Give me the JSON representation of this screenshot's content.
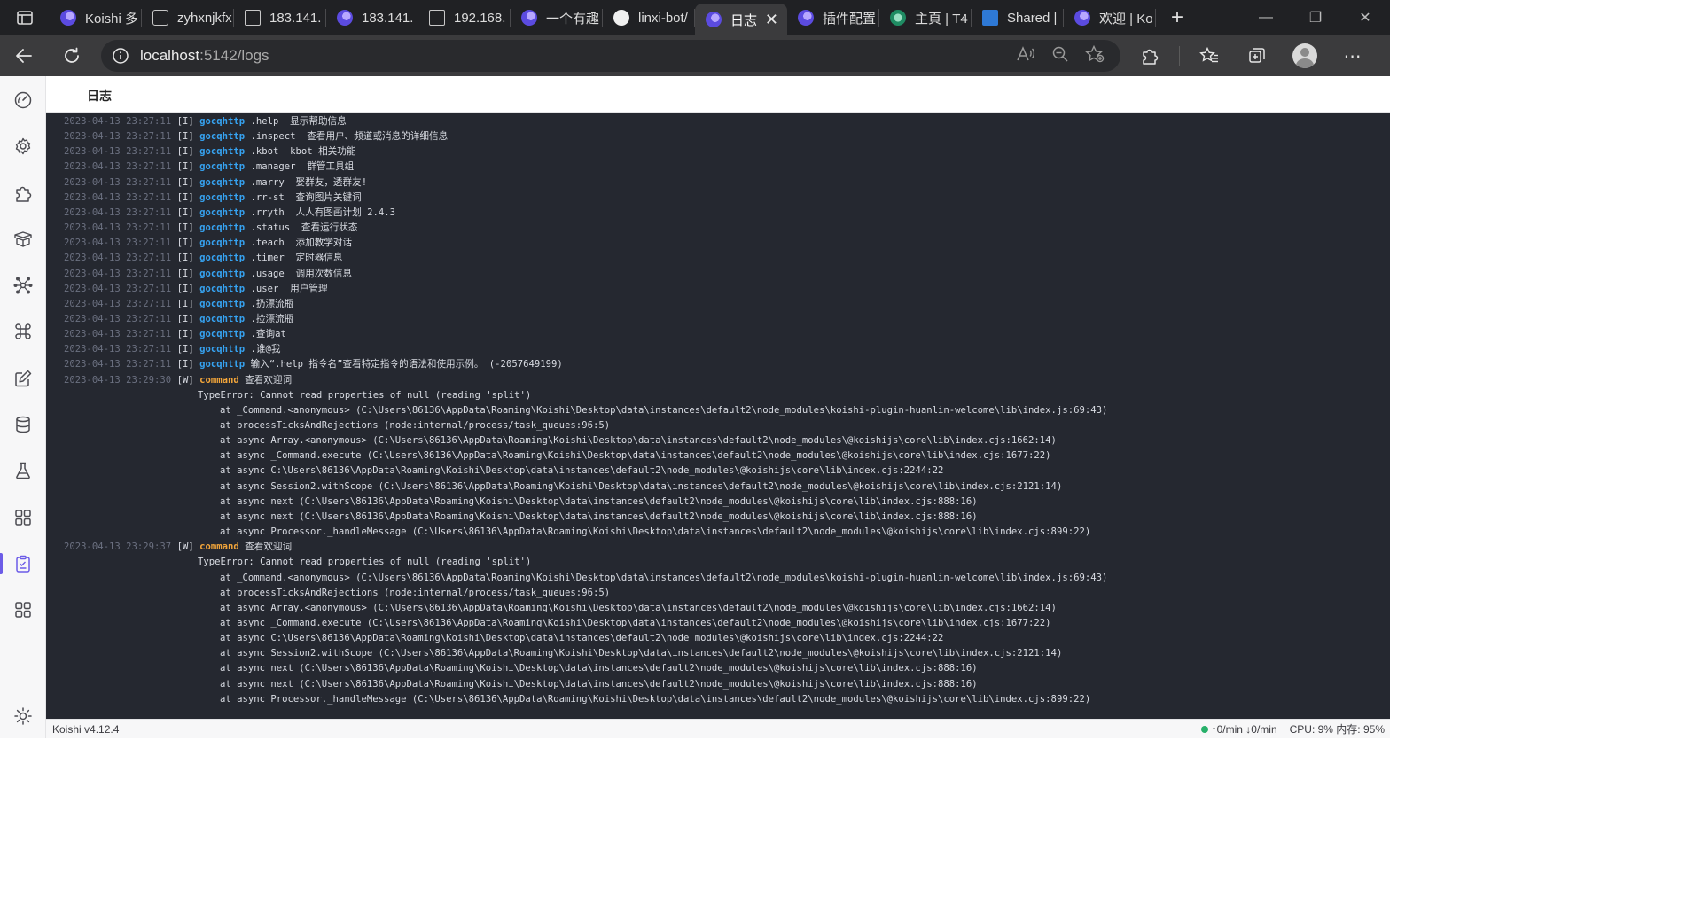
{
  "browser": {
    "tabs": [
      {
        "title": "Koishi 多",
        "favicon": "koishi-favicon",
        "active": false
      },
      {
        "title": "zyhxnjkfx",
        "favicon": "blocked-page-favicon",
        "active": false
      },
      {
        "title": "183.141.",
        "favicon": "document-favicon",
        "active": false
      },
      {
        "title": "183.141.",
        "favicon": "koishi-favicon",
        "active": false
      },
      {
        "title": "192.168.",
        "favicon": "document-favicon",
        "active": false
      },
      {
        "title": "一个有趣",
        "favicon": "koishi-favicon",
        "active": false
      },
      {
        "title": "linxi-bot/",
        "favicon": "github-favicon",
        "active": false
      },
      {
        "title": "日志",
        "favicon": "koishi-favicon",
        "active": true
      },
      {
        "title": "插件配置",
        "favicon": "koishi-favicon",
        "active": false
      },
      {
        "title": "主頁 | T4",
        "favicon": "green-site-favicon",
        "active": false
      },
      {
        "title": "Shared |",
        "favicon": "blue-doc-favicon",
        "active": false
      },
      {
        "title": "欢迎 | Ko",
        "favicon": "koishi-favicon",
        "active": false
      }
    ],
    "address": {
      "host": "localhost",
      "path": ":5142/logs"
    }
  },
  "page": {
    "title": "日志"
  },
  "sidebar": {
    "items": [
      {
        "name": "dashboard-icon",
        "active": false
      },
      {
        "name": "settings-gear-icon",
        "active": false
      },
      {
        "name": "plugin-puzzle-icon",
        "active": false
      },
      {
        "name": "package-box-icon",
        "active": false
      },
      {
        "name": "dependency-graph-icon",
        "active": false
      },
      {
        "name": "command-icon",
        "active": false
      },
      {
        "name": "edit-note-icon",
        "active": false
      },
      {
        "name": "database-icon",
        "active": false
      },
      {
        "name": "sandbox-flask-icon",
        "active": false
      },
      {
        "name": "apps-grid-icon",
        "active": false
      },
      {
        "name": "logs-clipboard-icon",
        "active": true
      },
      {
        "name": "apps-grid-icon-2",
        "active": false
      },
      {
        "name": "theme-sun-icon",
        "active": false
      }
    ]
  },
  "logs": [
    {
      "ts": "2023-04-13 23:27:11",
      "level": "[I]",
      "label": "gocqhttp",
      "msg": ".help  显示帮助信息"
    },
    {
      "ts": "2023-04-13 23:27:11",
      "level": "[I]",
      "label": "gocqhttp",
      "msg": ".inspect  查看用户、频道或消息的详细信息"
    },
    {
      "ts": "2023-04-13 23:27:11",
      "level": "[I]",
      "label": "gocqhttp",
      "msg": ".kbot  kbot 相关功能"
    },
    {
      "ts": "2023-04-13 23:27:11",
      "level": "[I]",
      "label": "gocqhttp",
      "msg": ".manager  群管工具组"
    },
    {
      "ts": "2023-04-13 23:27:11",
      "level": "[I]",
      "label": "gocqhttp",
      "msg": ".marry  娶群友，透群友!"
    },
    {
      "ts": "2023-04-13 23:27:11",
      "level": "[I]",
      "label": "gocqhttp",
      "msg": ".rr-st  查询图片关键词"
    },
    {
      "ts": "2023-04-13 23:27:11",
      "level": "[I]",
      "label": "gocqhttp",
      "msg": ".rryth  人人有图画计划 2.4.3"
    },
    {
      "ts": "2023-04-13 23:27:11",
      "level": "[I]",
      "label": "gocqhttp",
      "msg": ".status  查看运行状态"
    },
    {
      "ts": "2023-04-13 23:27:11",
      "level": "[I]",
      "label": "gocqhttp",
      "msg": ".teach  添加教学对话"
    },
    {
      "ts": "2023-04-13 23:27:11",
      "level": "[I]",
      "label": "gocqhttp",
      "msg": ".timer  定时器信息"
    },
    {
      "ts": "2023-04-13 23:27:11",
      "level": "[I]",
      "label": "gocqhttp",
      "msg": ".usage  调用次数信息"
    },
    {
      "ts": "2023-04-13 23:27:11",
      "level": "[I]",
      "label": "gocqhttp",
      "msg": ".user  用户管理"
    },
    {
      "ts": "2023-04-13 23:27:11",
      "level": "[I]",
      "label": "gocqhttp",
      "msg": ".扔漂流瓶"
    },
    {
      "ts": "2023-04-13 23:27:11",
      "level": "[I]",
      "label": "gocqhttp",
      "msg": ".捡漂流瓶"
    },
    {
      "ts": "2023-04-13 23:27:11",
      "level": "[I]",
      "label": "gocqhttp",
      "msg": ".查询at"
    },
    {
      "ts": "2023-04-13 23:27:11",
      "level": "[I]",
      "label": "gocqhttp",
      "msg": ".谁@我"
    },
    {
      "ts": "2023-04-13 23:27:11",
      "level": "[I]",
      "label": "gocqhttp",
      "msg": "输入“.help 指令名”查看特定指令的语法和使用示例。 (-2057649199)"
    },
    {
      "ts": "2023-04-13 23:29:30",
      "level": "[W]",
      "label": "command",
      "msg": "查看欢迎词"
    },
    {
      "stack": "TypeError: Cannot read properties of null (reading 'split')",
      "indent": 1
    },
    {
      "stack": "at _Command.<anonymous> (C:\\Users\\86136\\AppData\\Roaming\\Koishi\\Desktop\\data\\instances\\default2\\node_modules\\koishi-plugin-huanlin-welcome\\lib\\index.js:69:43)",
      "indent": 2
    },
    {
      "stack": "at processTicksAndRejections (node:internal/process/task_queues:96:5)",
      "indent": 2
    },
    {
      "stack": "at async Array.<anonymous> (C:\\Users\\86136\\AppData\\Roaming\\Koishi\\Desktop\\data\\instances\\default2\\node_modules\\@koishijs\\core\\lib\\index.cjs:1662:14)",
      "indent": 2
    },
    {
      "stack": "at async _Command.execute (C:\\Users\\86136\\AppData\\Roaming\\Koishi\\Desktop\\data\\instances\\default2\\node_modules\\@koishijs\\core\\lib\\index.cjs:1677:22)",
      "indent": 2
    },
    {
      "stack": "at async C:\\Users\\86136\\AppData\\Roaming\\Koishi\\Desktop\\data\\instances\\default2\\node_modules\\@koishijs\\core\\lib\\index.cjs:2244:22",
      "indent": 2
    },
    {
      "stack": "at async Session2.withScope (C:\\Users\\86136\\AppData\\Roaming\\Koishi\\Desktop\\data\\instances\\default2\\node_modules\\@koishijs\\core\\lib\\index.cjs:2121:14)",
      "indent": 2
    },
    {
      "stack": "at async next (C:\\Users\\86136\\AppData\\Roaming\\Koishi\\Desktop\\data\\instances\\default2\\node_modules\\@koishijs\\core\\lib\\index.cjs:888:16)",
      "indent": 2
    },
    {
      "stack": "at async next (C:\\Users\\86136\\AppData\\Roaming\\Koishi\\Desktop\\data\\instances\\default2\\node_modules\\@koishijs\\core\\lib\\index.cjs:888:16)",
      "indent": 2
    },
    {
      "stack": "at async Processor._handleMessage (C:\\Users\\86136\\AppData\\Roaming\\Koishi\\Desktop\\data\\instances\\default2\\node_modules\\@koishijs\\core\\lib\\index.cjs:899:22)",
      "indent": 2
    },
    {
      "ts": "2023-04-13 23:29:37",
      "level": "[W]",
      "label": "command",
      "msg": "查看欢迎词"
    },
    {
      "stack": "TypeError: Cannot read properties of null (reading 'split')",
      "indent": 1
    },
    {
      "stack": "at _Command.<anonymous> (C:\\Users\\86136\\AppData\\Roaming\\Koishi\\Desktop\\data\\instances\\default2\\node_modules\\koishi-plugin-huanlin-welcome\\lib\\index.js:69:43)",
      "indent": 2
    },
    {
      "stack": "at processTicksAndRejections (node:internal/process/task_queues:96:5)",
      "indent": 2
    },
    {
      "stack": "at async Array.<anonymous> (C:\\Users\\86136\\AppData\\Roaming\\Koishi\\Desktop\\data\\instances\\default2\\node_modules\\@koishijs\\core\\lib\\index.cjs:1662:14)",
      "indent": 2
    },
    {
      "stack": "at async _Command.execute (C:\\Users\\86136\\AppData\\Roaming\\Koishi\\Desktop\\data\\instances\\default2\\node_modules\\@koishijs\\core\\lib\\index.cjs:1677:22)",
      "indent": 2
    },
    {
      "stack": "at async C:\\Users\\86136\\AppData\\Roaming\\Koishi\\Desktop\\data\\instances\\default2\\node_modules\\@koishijs\\core\\lib\\index.cjs:2244:22",
      "indent": 2
    },
    {
      "stack": "at async Session2.withScope (C:\\Users\\86136\\AppData\\Roaming\\Koishi\\Desktop\\data\\instances\\default2\\node_modules\\@koishijs\\core\\lib\\index.cjs:2121:14)",
      "indent": 2
    },
    {
      "stack": "at async next (C:\\Users\\86136\\AppData\\Roaming\\Koishi\\Desktop\\data\\instances\\default2\\node_modules\\@koishijs\\core\\lib\\index.cjs:888:16)",
      "indent": 2
    },
    {
      "stack": "at async next (C:\\Users\\86136\\AppData\\Roaming\\Koishi\\Desktop\\data\\instances\\default2\\node_modules\\@koishijs\\core\\lib\\index.cjs:888:16)",
      "indent": 2
    },
    {
      "stack": "at async Processor._handleMessage (C:\\Users\\86136\\AppData\\Roaming\\Koishi\\Desktop\\data\\instances\\default2\\node_modules\\@koishijs\\core\\lib\\index.cjs:899:22)",
      "indent": 2
    }
  ],
  "status": {
    "version": "Koishi v4.12.4",
    "rate_up": "↑0/min",
    "rate_down": "↓0/min",
    "system": "CPU: 9% 内存: 95%"
  },
  "colors": {
    "accent": "#6c5ce7",
    "log_bg": "#252830",
    "info_label": "#36a2f0",
    "warn_label": "#f2a53a",
    "online": "#27b06a"
  }
}
